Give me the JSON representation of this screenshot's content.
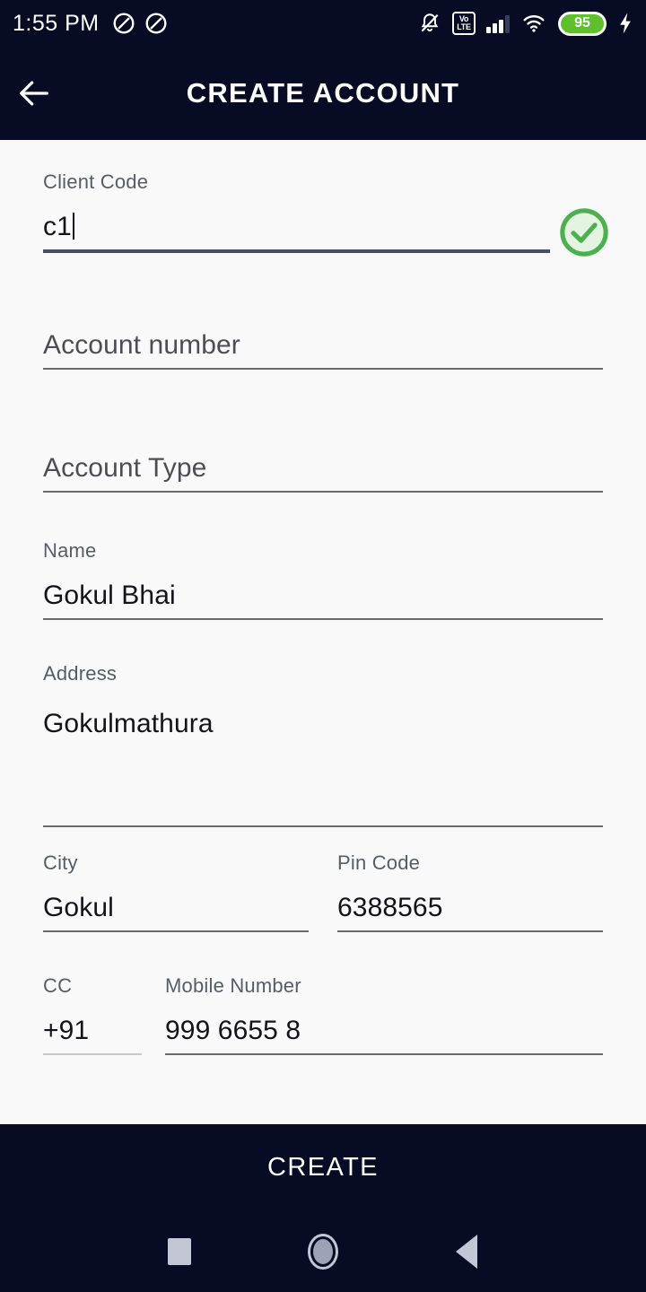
{
  "status_bar": {
    "time": "1:55 PM",
    "left_icons": [
      "dnd-icon",
      "dnd-icon"
    ],
    "right_icons": [
      "bell-muted-icon",
      "volte-icon",
      "signal-icon",
      "wifi-icon",
      "battery-icon",
      "charging-bolt-icon"
    ],
    "volte_top": "Vo",
    "volte_bottom": "LTE",
    "battery_percent": "95"
  },
  "app_bar": {
    "back_icon": "arrow-left-icon",
    "title": "CREATE ACCOUNT"
  },
  "form": {
    "client_code": {
      "label": "Client Code",
      "value": "c1",
      "placeholder": "Client Code",
      "focused": true,
      "validation_icon": "check-circle-icon"
    },
    "account_number": {
      "label": "Account number",
      "value": "",
      "placeholder": "Account number"
    },
    "account_type": {
      "label": "Account Type",
      "value": "",
      "placeholder": "Account Type"
    },
    "name": {
      "label": "Name",
      "value": "Gokul Bhai",
      "placeholder": "Name"
    },
    "address": {
      "label": "Address",
      "value": "Gokulmathura",
      "placeholder": "Address"
    },
    "city": {
      "label": "City",
      "value": "Gokul",
      "placeholder": "City"
    },
    "pin_code": {
      "label": "Pin Code",
      "value": "6388565",
      "placeholder": "Pin Code"
    },
    "cc": {
      "label": "CC",
      "value": "+91",
      "placeholder": "CC"
    },
    "mobile_number": {
      "label": "Mobile Number",
      "value": "999 6655 8",
      "placeholder": "Mobile Number"
    }
  },
  "create_button": {
    "label": "CREATE"
  },
  "nav_bar": {
    "recents_icon": "square-icon",
    "home_icon": "circle-icon",
    "back_icon": "triangle-back-icon"
  },
  "colors": {
    "chrome": "#070b23",
    "background": "#f9f9fa",
    "focus_underline": "#474f6b",
    "underline": "#6b6b6b",
    "disabled_underline": "#c9c9c9",
    "success_green": "#4caf50",
    "battery_green": "#5ec02c"
  }
}
